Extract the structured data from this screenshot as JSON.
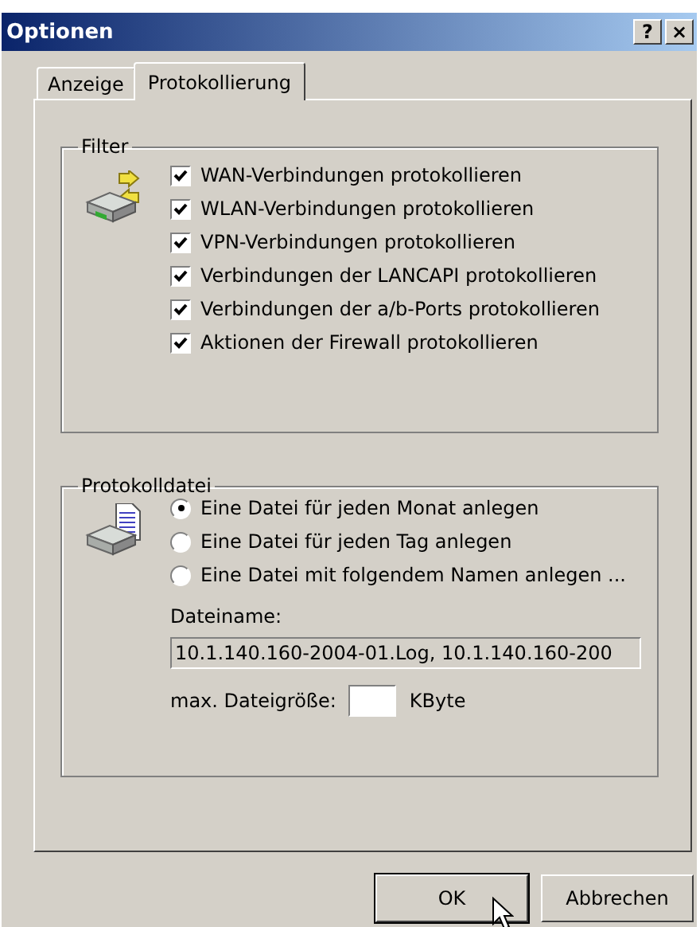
{
  "window": {
    "title": "Optionen",
    "title_buttons": [
      "?",
      "×"
    ]
  },
  "tabs": [
    {
      "label": "Anzeige",
      "selected": false
    },
    {
      "label": "Protokollierung",
      "selected": true
    }
  ],
  "filter": {
    "title": "Filter",
    "options": [
      {
        "label": "WAN-Verbindungen protokollieren",
        "checked": true
      },
      {
        "label": "WLAN-Verbindungen protokollieren",
        "checked": true
      },
      {
        "label": "VPN-Verbindungen protokollieren",
        "checked": true
      },
      {
        "label": "Verbindungen der LANCAPI protokollieren",
        "checked": true
      },
      {
        "label": "Verbindungen der a/b-Ports protokollieren",
        "checked": true
      },
      {
        "label": "Aktionen der Firewall protokollieren",
        "checked": true
      }
    ]
  },
  "logfile": {
    "title": "Protokolldatei",
    "options": [
      {
        "label": "Eine Datei für jeden Monat anlegen",
        "selected": true
      },
      {
        "label": "Eine Datei für jeden Tag anlegen",
        "selected": false
      },
      {
        "label": "Eine Datei mit folgendem Namen anlegen ...",
        "selected": false
      }
    ],
    "filename_label": "Dateiname:",
    "filename_value": "10.1.140.160-2004-01.Log, 10.1.140.160-200",
    "filename_disabled": true,
    "maxsize_label": "max. Dateigröße:",
    "maxsize_unit": "KByte"
  },
  "buttons": [
    "OK",
    "Abbrechen"
  ]
}
